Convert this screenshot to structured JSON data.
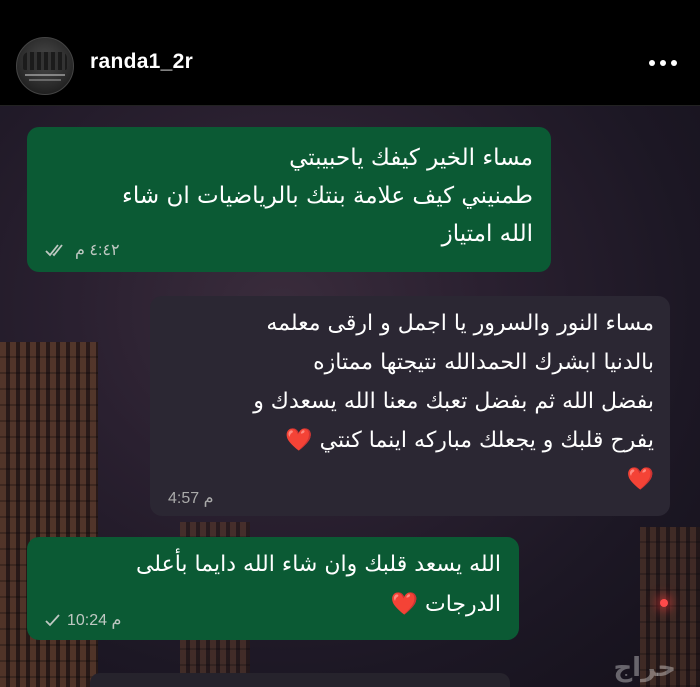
{
  "header": {
    "username": "randa1_2r",
    "avatar_icon": "profile-avatar",
    "menu_icon": "more-horizontal-icon"
  },
  "messages": [
    {
      "direction": "outgoing",
      "lines": [
        "مساء الخير كيفك ياحبيبتي",
        "طمنيني كيف علامة بنتك بالرياضيات ان شاء",
        "الله امتياز"
      ],
      "time": "٤:٤٢ م",
      "status_icon": "double-check-icon"
    },
    {
      "direction": "incoming",
      "lines": [
        "مساء النور والسرور يا اجمل و ارقى معلمه",
        "بالدنيا ابشرك الحمدالله نتيجتها ممتازه",
        "بفضل الله ثم بفضل تعبك معنا الله يسعدك و",
        "يفرح قلبك و يجعلك مباركه اينما كنتي ❤️",
        "❤️"
      ],
      "time": "4:57 م"
    },
    {
      "direction": "outgoing",
      "lines": [
        "الله يسعد قلبك وان شاء الله دايما بأعلى",
        "الدرجات ❤️"
      ],
      "time": "10:24 م",
      "status_icon": "single-check-icon"
    }
  ],
  "watermark": "حراج",
  "colors": {
    "outgoing_bubble": "#0b5a34",
    "incoming_bubble": "#2b2733",
    "heart": "#e8202a"
  }
}
